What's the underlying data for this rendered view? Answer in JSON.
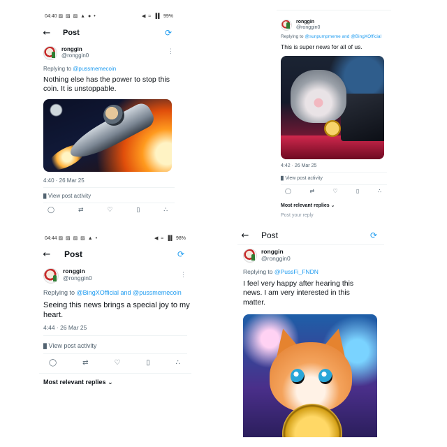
{
  "panel_top_left": {
    "status": {
      "time": "04:40",
      "left_icons": "▨ ▨ ▨ ▲ ● •",
      "right_icons": "◀ ≈ ▐▌",
      "battery": "99%"
    },
    "header": {
      "back_icon": "arrow-left-icon",
      "title": "Post",
      "refresh_icon": "refresh-icon"
    },
    "author": {
      "name": "ronggin",
      "handle": "@ronggin0"
    },
    "replying_to": {
      "prefix": "Replying to",
      "mentions": "@pussmemecoin"
    },
    "text": "Nothing else has the power to stop this coin. It is unstoppable.",
    "timestamp": "4:40 · 26 Mar 25",
    "view_activity": "View post activity",
    "image": "rocket-cat-space-image"
  },
  "panel_top_right": {
    "author": {
      "name": "ronggin",
      "handle": "@ronggin0"
    },
    "replying_to": {
      "prefix": "Replying to",
      "mentions": "@sunpumpmeme and @BingXOfficial"
    },
    "text": "This is super news for all of us.",
    "timestamp": "4:42 · 26 Mar 25",
    "view_activity": "View post activity",
    "relevant_replies": "Most relevant replies",
    "post_reply": "Post your reply",
    "image": "laughing-cat-laptop-image"
  },
  "panel_bottom_left": {
    "status": {
      "time": "04:44",
      "left_icons": "▨ ▨ ▨ ▨ ▲ •",
      "right_icons": "◀ ≈ ▐▌",
      "battery": "98%"
    },
    "header": {
      "back_icon": "arrow-left-icon",
      "title": "Post",
      "refresh_icon": "refresh-icon"
    },
    "author": {
      "name": "ronggin",
      "handle": "@ronggin0"
    },
    "replying_to": {
      "prefix": "Replying to",
      "mentions": "@BingXOfficial and @pussmemecoin"
    },
    "text": "Seeing this news brings a special joy to my heart.",
    "timestamp": "4:44 · 26 Mar 25",
    "view_activity": "View post activity",
    "relevant_replies": "Most relevant replies"
  },
  "panel_bottom_right": {
    "header": {
      "back_icon": "arrow-left-icon",
      "title": "Post",
      "refresh_icon": "refresh-icon"
    },
    "author": {
      "name": "ronggin",
      "handle": "@ronggin0"
    },
    "replying_to": {
      "prefix": "Replying to",
      "mentions": "@PussFi_FNDN"
    },
    "text": "I feel very happy after hearing this news. I am very interested in this matter.",
    "image": "happy-orange-cat-coin-image"
  },
  "action_icons": [
    "reply-icon",
    "repost-icon",
    "like-icon",
    "bookmark-icon",
    "share-icon"
  ],
  "action_glyphs": [
    "◯",
    "⇄",
    "♡",
    "▯",
    "∴"
  ],
  "colors": {
    "accent": "#1d9bf0",
    "secondary_text": "#536471"
  }
}
